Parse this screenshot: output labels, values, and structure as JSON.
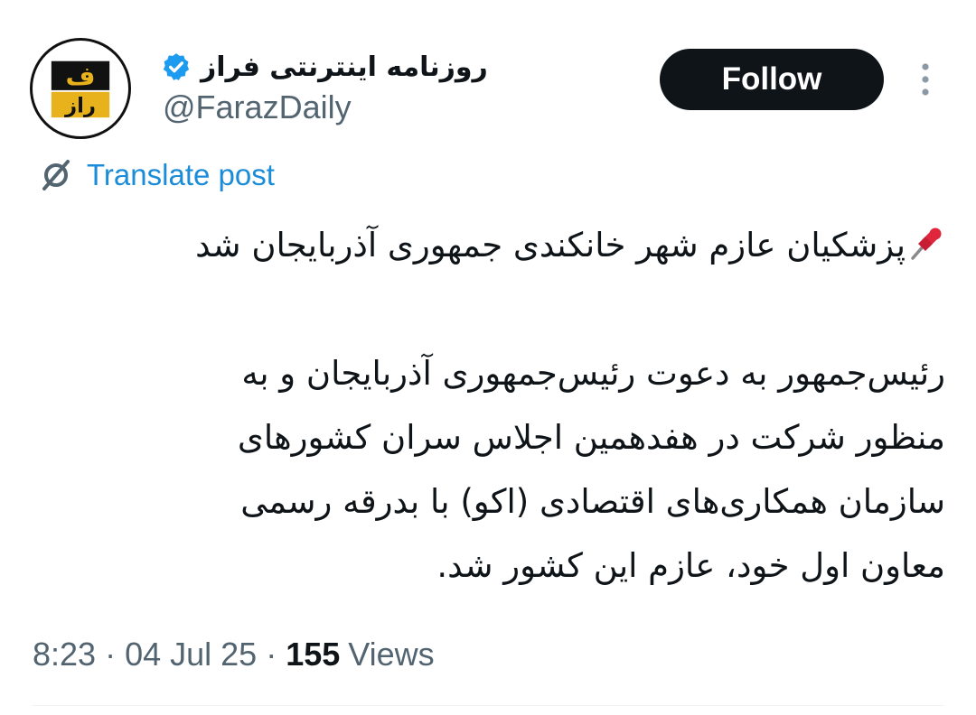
{
  "author": {
    "display_name": "روزنامه اینترنتی فراز",
    "handle": "@FarazDaily",
    "avatar_text_top": "ف",
    "avatar_text_bottom": "راز",
    "verified_color": "#1d9bf0"
  },
  "actions": {
    "follow_label": "Follow",
    "more_icon": "more-vertical-icon"
  },
  "translate": {
    "label": "Translate post",
    "icon": "globe-slash-icon"
  },
  "post": {
    "lines": [
      "پزشکیان عازم شهر خانکندی جمهوری آذربایجان شد",
      "",
      "رئیس‌جمهور به دعوت رئیس‌جمهوری آذربایجان و به",
      "منظور شرکت در هفدهمین اجلاس سران کشورهای",
      "سازمان همکاری‌های اقتصادی (اکو) با بدرقه رسمی",
      "معاون اول خود، عازم این کشور شد."
    ],
    "lead_icon": "pushpin-icon"
  },
  "meta": {
    "time": "8:23",
    "separator": "·",
    "date": "04 Jul 25",
    "views_count": "155",
    "views_label": "Views"
  },
  "colors": {
    "accent": "#1d9bf0",
    "text": "#0f1419",
    "muted": "#536471",
    "logo_yellow": "#e8b21d"
  }
}
